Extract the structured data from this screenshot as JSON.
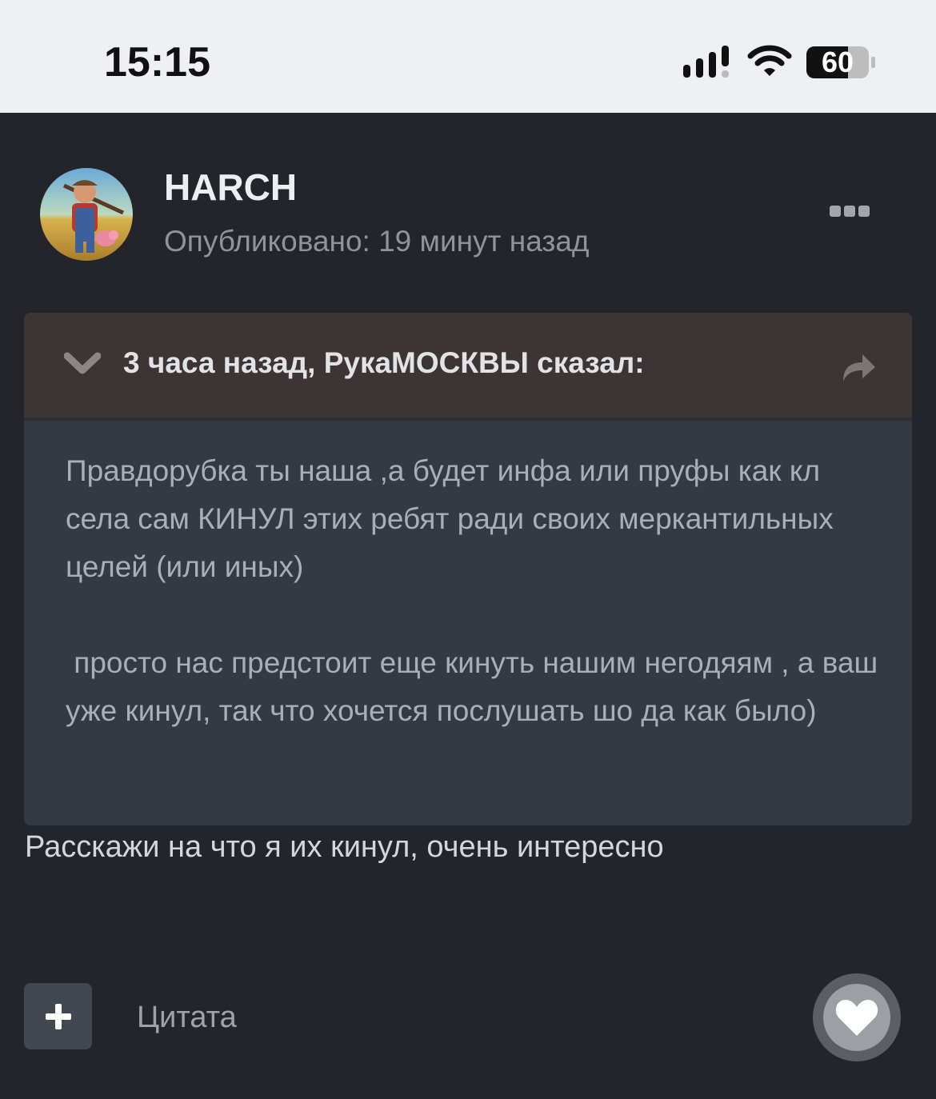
{
  "status_bar": {
    "time": "15:15",
    "battery": "60",
    "icons": [
      "signal-icon",
      "wifi-icon",
      "battery-icon"
    ]
  },
  "post": {
    "author": "HARCH",
    "published": "Опубликовано: 19 минут назад",
    "avatar_icon": "farmer-avatar",
    "menu_icon": "more-dots-icon",
    "quote": {
      "citation": "3 часа назад, РукаМОСКВЫ сказал:",
      "paragraphs": [
        "Правдорубка ты наша ,а будет инфа или пруфы как кл села сам КИНУЛ этих ребят ради своих меркантильных целей (или иных)",
        " просто нас предстоит еще кинуть нашим негодяям , а ваш уже кинул, так что хочется послушать шо да как было)"
      ]
    },
    "reply": "Расскажи на что я их кинул, очень интересно"
  },
  "actions": {
    "add_icon": "plus-icon",
    "quote_label": "Цитата",
    "like_icon": "heart-icon"
  },
  "colors": {
    "background": "#23252b",
    "quote_body": "#353a42",
    "quote_header": "#3d3535",
    "status_bar": "#eef0f4"
  }
}
